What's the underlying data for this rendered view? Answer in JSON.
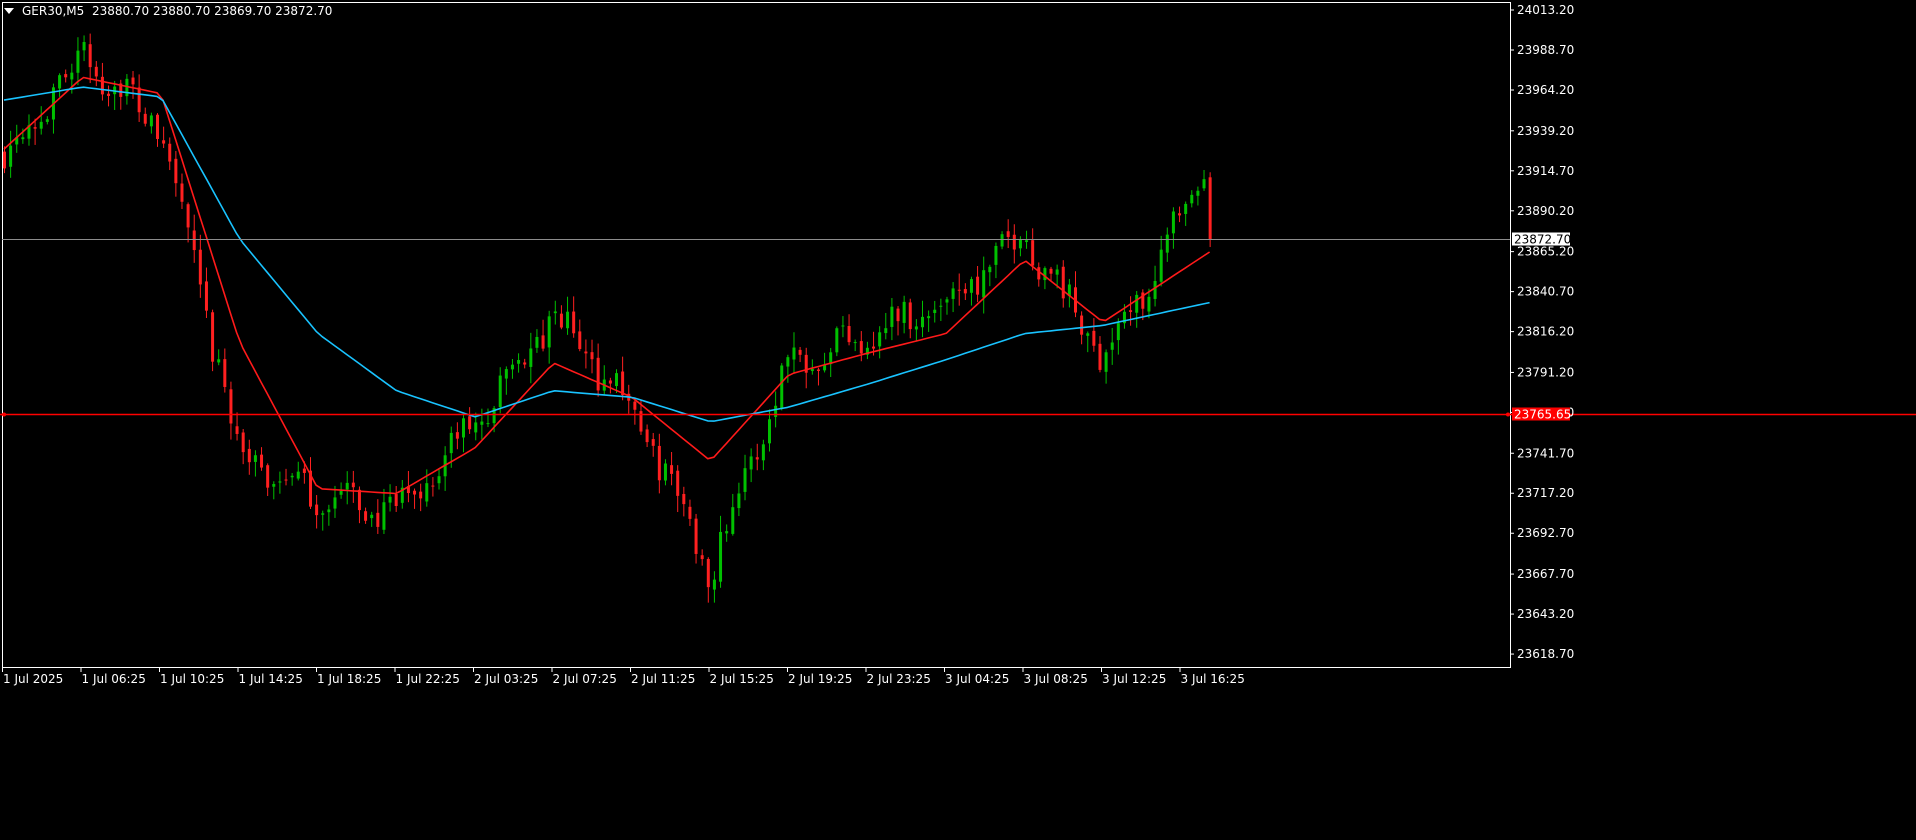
{
  "header": {
    "symbol_label": "GER30,M5",
    "ohlc_text": "23880.70 23880.70 23869.70 23872.70"
  },
  "colors": {
    "background": "#000000",
    "axis": "#ffffff",
    "bull_candle": "#00c000",
    "bear_candle": "#ff2020",
    "ma_fast": "#ff1a1a",
    "ma_slow": "#19c3ff",
    "bid_line": "#8c8c8c",
    "level_line": "#ff0000"
  },
  "chart_data": {
    "type": "candlestick",
    "symbol": "GER30",
    "timeframe": "M5",
    "ylim": [
      23606,
      24018
    ],
    "y_ticks": [
      "24013.20",
      "23988.70",
      "23964.20",
      "23939.20",
      "23914.70",
      "23890.20",
      "23865.20",
      "23840.70",
      "23816.20",
      "23791.20",
      "23766.70",
      "23741.70",
      "23717.20",
      "23692.70",
      "23667.70",
      "23643.20",
      "23618.70"
    ],
    "x_ticks": [
      "1 Jul 2025",
      "1 Jul 06:25",
      "1 Jul 10:25",
      "1 Jul 14:25",
      "1 Jul 18:25",
      "1 Jul 22:25",
      "2 Jul 03:25",
      "2 Jul 07:25",
      "2 Jul 11:25",
      "2 Jul 15:25",
      "2 Jul 19:25",
      "2 Jul 23:25",
      "3 Jul 04:25",
      "3 Jul 08:25",
      "3 Jul 12:25",
      "3 Jul 16:25"
    ],
    "current_price": "23872.70",
    "horizontal_level": "23765.65",
    "close_path": [
      {
        "x": "1 Jul 2025",
        "close": 23925
      },
      {
        "x": "1 Jul 06:25",
        "close": 23985
      },
      {
        "x": "1 Jul 10:25",
        "close": 23940
      },
      {
        "x": "1 Jul 14:25",
        "close": 23740
      },
      {
        "x": "1 Jul 18:25",
        "close": 23715
      },
      {
        "x": "1 Jul 22:25",
        "close": 23705
      },
      {
        "x": "2 Jul 03:25",
        "close": 23760
      },
      {
        "x": "2 Jul 07:25",
        "close": 23825
      },
      {
        "x": "2 Jul 11:25",
        "close": 23770
      },
      {
        "x": "2 Jul 15:25",
        "close": 23670
      },
      {
        "x": "2 Jul 19:25",
        "close": 23800
      },
      {
        "x": "2 Jul 23:25",
        "close": 23815
      },
      {
        "x": "3 Jul 04:25",
        "close": 23835
      },
      {
        "x": "3 Jul 08:25",
        "close": 23875
      },
      {
        "x": "3 Jul 12:25",
        "close": 23800
      },
      {
        "x": "3 Jul 16:25",
        "close": 23915
      }
    ],
    "series": [
      {
        "color": "#ff1a1a",
        "values": [
          {
            "x": "1 Jul 2025",
            "y": 23928
          },
          {
            "x": "1 Jul 06:25",
            "y": 23972
          },
          {
            "x": "1 Jul 10:25",
            "y": 23962
          },
          {
            "x": "1 Jul 14:25",
            "y": 23810
          },
          {
            "x": "1 Jul 18:25",
            "y": 23720
          },
          {
            "x": "1 Jul 22:25",
            "y": 23717
          },
          {
            "x": "2 Jul 03:25",
            "y": 23745
          },
          {
            "x": "2 Jul 07:25",
            "y": 23797
          },
          {
            "x": "2 Jul 11:25",
            "y": 23776
          },
          {
            "x": "2 Jul 15:25",
            "y": 23737
          },
          {
            "x": "2 Jul 19:25",
            "y": 23790
          },
          {
            "x": "2 Jul 23:25",
            "y": 23803
          },
          {
            "x": "3 Jul 04:25",
            "y": 23815
          },
          {
            "x": "3 Jul 08:25",
            "y": 23860
          },
          {
            "x": "3 Jul 12:25",
            "y": 23822
          },
          {
            "x": "3 Jul 16:25",
            "y": 23865
          }
        ]
      },
      {
        "color": "#19c3ff",
        "values": [
          {
            "x": "1 Jul 2025",
            "y": 23958
          },
          {
            "x": "1 Jul 06:25",
            "y": 23966
          },
          {
            "x": "1 Jul 10:25",
            "y": 23960
          },
          {
            "x": "1 Jul 14:25",
            "y": 23873
          },
          {
            "x": "1 Jul 18:25",
            "y": 23815
          },
          {
            "x": "1 Jul 22:25",
            "y": 23780
          },
          {
            "x": "2 Jul 03:25",
            "y": 23764
          },
          {
            "x": "2 Jul 07:25",
            "y": 23780
          },
          {
            "x": "2 Jul 11:25",
            "y": 23776
          },
          {
            "x": "2 Jul 15:25",
            "y": 23761
          },
          {
            "x": "2 Jul 19:25",
            "y": 23770
          },
          {
            "x": "2 Jul 23:25",
            "y": 23784
          },
          {
            "x": "3 Jul 04:25",
            "y": 23799
          },
          {
            "x": "3 Jul 08:25",
            "y": 23815
          },
          {
            "x": "3 Jul 12:25",
            "y": 23820
          },
          {
            "x": "3 Jul 16:25",
            "y": 23834
          }
        ]
      }
    ]
  }
}
